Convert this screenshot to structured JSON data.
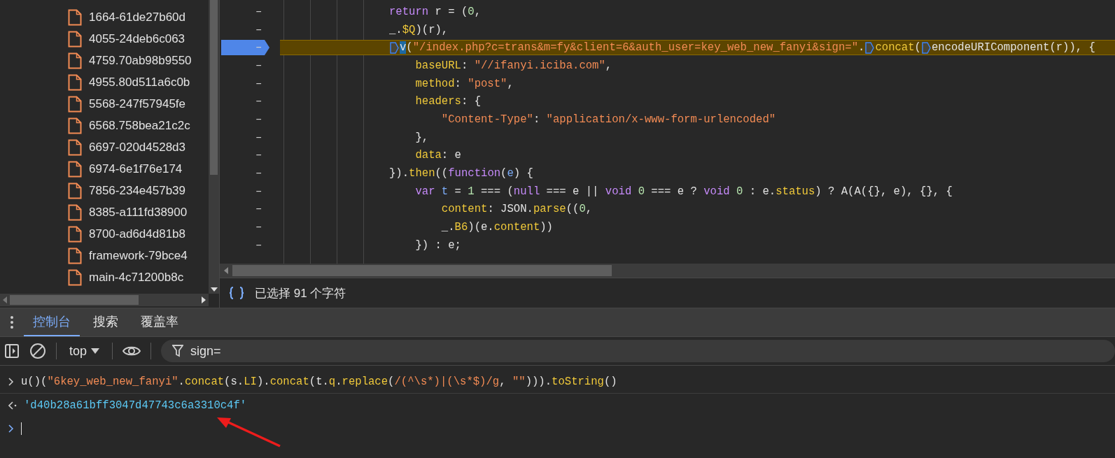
{
  "sources": {
    "files": [
      "1664-61de27b60d",
      "4055-24deb6c063",
      "4759.70ab98b9550",
      "4955.80d511a6c0b",
      "5568-247f57945fe",
      "6568.758bea21c2c",
      "6697-020d4528d3",
      "6974-6e1f76e174",
      "7856-234e457b39",
      "8385-a111fd38900",
      "8700-ad6d4d81b8",
      "framework-79bce4",
      "main-4c71200b8c"
    ]
  },
  "editor": {
    "lines": [
      {
        "gutter": "–",
        "breakpoint": false,
        "tokens": [
          {
            "t": "return",
            "kind": "kw"
          },
          {
            "t": " r = (",
            "kind": "plain"
          },
          {
            "t": "0",
            "kind": "num"
          },
          {
            "t": ",",
            "kind": "plain"
          }
        ]
      },
      {
        "gutter": "–",
        "breakpoint": false,
        "tokens": [
          {
            "t": "_.",
            "kind": "plain"
          },
          {
            "t": "$Q",
            "kind": "prop"
          },
          {
            "t": ")(r),",
            "kind": "plain"
          }
        ]
      },
      {
        "gutter": "–",
        "breakpoint": true,
        "tokens": [
          {
            "kind": "bp"
          },
          {
            "t": "v",
            "kind": "sel"
          },
          {
            "t": "(",
            "kind": "plain"
          },
          {
            "t": "\"/index.php?c=trans&m=fy&client=6&auth_user=key_web_new_fanyi&sign=\"",
            "kind": "str"
          },
          {
            "t": ".",
            "kind": "plain"
          },
          {
            "kind": "bp"
          },
          {
            "t": "concat",
            "kind": "prop"
          },
          {
            "t": "(",
            "kind": "plain"
          },
          {
            "kind": "bp"
          },
          {
            "t": "encodeURIComponent(r)), {",
            "kind": "plain"
          }
        ]
      },
      {
        "gutter": "–",
        "breakpoint": false,
        "tokens": [
          {
            "t": "    baseURL",
            "kind": "prop"
          },
          {
            "t": ": ",
            "kind": "plain"
          },
          {
            "t": "\"//ifanyi.iciba.com\"",
            "kind": "str"
          },
          {
            "t": ",",
            "kind": "plain"
          }
        ]
      },
      {
        "gutter": "–",
        "breakpoint": false,
        "tokens": [
          {
            "t": "    method",
            "kind": "prop"
          },
          {
            "t": ": ",
            "kind": "plain"
          },
          {
            "t": "\"post\"",
            "kind": "str"
          },
          {
            "t": ",",
            "kind": "plain"
          }
        ]
      },
      {
        "gutter": "–",
        "breakpoint": false,
        "tokens": [
          {
            "t": "    headers",
            "kind": "prop"
          },
          {
            "t": ": {",
            "kind": "plain"
          }
        ]
      },
      {
        "gutter": "–",
        "breakpoint": false,
        "tokens": [
          {
            "t": "        \"Content-Type\"",
            "kind": "str"
          },
          {
            "t": ": ",
            "kind": "plain"
          },
          {
            "t": "\"application/x-www-form-urlencoded\"",
            "kind": "str"
          }
        ]
      },
      {
        "gutter": "–",
        "breakpoint": false,
        "tokens": [
          {
            "t": "    },",
            "kind": "plain"
          }
        ]
      },
      {
        "gutter": "–",
        "breakpoint": false,
        "tokens": [
          {
            "t": "    data",
            "kind": "prop"
          },
          {
            "t": ": e",
            "kind": "plain"
          }
        ]
      },
      {
        "gutter": "–",
        "breakpoint": false,
        "tokens": [
          {
            "t": "}).",
            "kind": "plain"
          },
          {
            "t": "then",
            "kind": "prop"
          },
          {
            "t": "((",
            "kind": "plain"
          },
          {
            "t": "function",
            "kind": "kw"
          },
          {
            "t": "(",
            "kind": "plain"
          },
          {
            "t": "e",
            "kind": "var"
          },
          {
            "t": ") {",
            "kind": "plain"
          }
        ]
      },
      {
        "gutter": "–",
        "breakpoint": false,
        "tokens": [
          {
            "t": "    var ",
            "kind": "kw"
          },
          {
            "t": "t",
            "kind": "var"
          },
          {
            "t": " = ",
            "kind": "plain"
          },
          {
            "t": "1",
            "kind": "num"
          },
          {
            "t": " === (",
            "kind": "plain"
          },
          {
            "t": "null",
            "kind": "kw"
          },
          {
            "t": " === e || ",
            "kind": "plain"
          },
          {
            "t": "void ",
            "kind": "kw"
          },
          {
            "t": "0",
            "kind": "num"
          },
          {
            "t": " === e ? ",
            "kind": "plain"
          },
          {
            "t": "void ",
            "kind": "kw"
          },
          {
            "t": "0",
            "kind": "num"
          },
          {
            "t": " : e.",
            "kind": "plain"
          },
          {
            "t": "status",
            "kind": "prop"
          },
          {
            "t": ") ? A(A({}, e), {}, {",
            "kind": "plain"
          }
        ]
      },
      {
        "gutter": "–",
        "breakpoint": false,
        "tokens": [
          {
            "t": "        content",
            "kind": "prop"
          },
          {
            "t": ": JSON.",
            "kind": "plain"
          },
          {
            "t": "parse",
            "kind": "prop"
          },
          {
            "t": "((",
            "kind": "plain"
          },
          {
            "t": "0",
            "kind": "num"
          },
          {
            "t": ",",
            "kind": "plain"
          }
        ]
      },
      {
        "gutter": "–",
        "breakpoint": false,
        "tokens": [
          {
            "t": "        _.",
            "kind": "plain"
          },
          {
            "t": "B6",
            "kind": "prop"
          },
          {
            "t": ")(e.",
            "kind": "plain"
          },
          {
            "t": "content",
            "kind": "prop"
          },
          {
            "t": "))",
            "kind": "plain"
          }
        ]
      },
      {
        "gutter": "–",
        "breakpoint": false,
        "tokens": [
          {
            "t": "    }) : e;",
            "kind": "plain"
          }
        ]
      }
    ],
    "status": "已选择 91 个字符"
  },
  "drawer": {
    "tabs": [
      {
        "label": "控制台",
        "selected": true
      },
      {
        "label": "搜索",
        "selected": false
      },
      {
        "label": "覆盖率",
        "selected": false
      }
    ],
    "context": "top",
    "filter": "sign="
  },
  "console": {
    "input": [
      {
        "t": "u()(",
        "kind": "plain"
      },
      {
        "t": "\"6key_web_new_fanyi\"",
        "kind": "str"
      },
      {
        "t": ".",
        "kind": "plain"
      },
      {
        "t": "concat",
        "kind": "prop"
      },
      {
        "t": "(s.",
        "kind": "plain"
      },
      {
        "t": "LI",
        "kind": "prop"
      },
      {
        "t": ").",
        "kind": "plain"
      },
      {
        "t": "concat",
        "kind": "prop"
      },
      {
        "t": "(t.",
        "kind": "plain"
      },
      {
        "t": "q",
        "kind": "prop"
      },
      {
        "t": ".",
        "kind": "plain"
      },
      {
        "t": "replace",
        "kind": "prop"
      },
      {
        "t": "(",
        "kind": "plain"
      },
      {
        "t": "/(^\\s*)|(\\s*$)/g",
        "kind": "str"
      },
      {
        "t": ", ",
        "kind": "plain"
      },
      {
        "t": "\"\"",
        "kind": "str"
      },
      {
        "t": "))).",
        "kind": "plain"
      },
      {
        "t": "toString",
        "kind": "prop"
      },
      {
        "t": "()",
        "kind": "plain"
      }
    ],
    "result": "'d40b28a61bff3047d47743c6a3310c4f'"
  }
}
